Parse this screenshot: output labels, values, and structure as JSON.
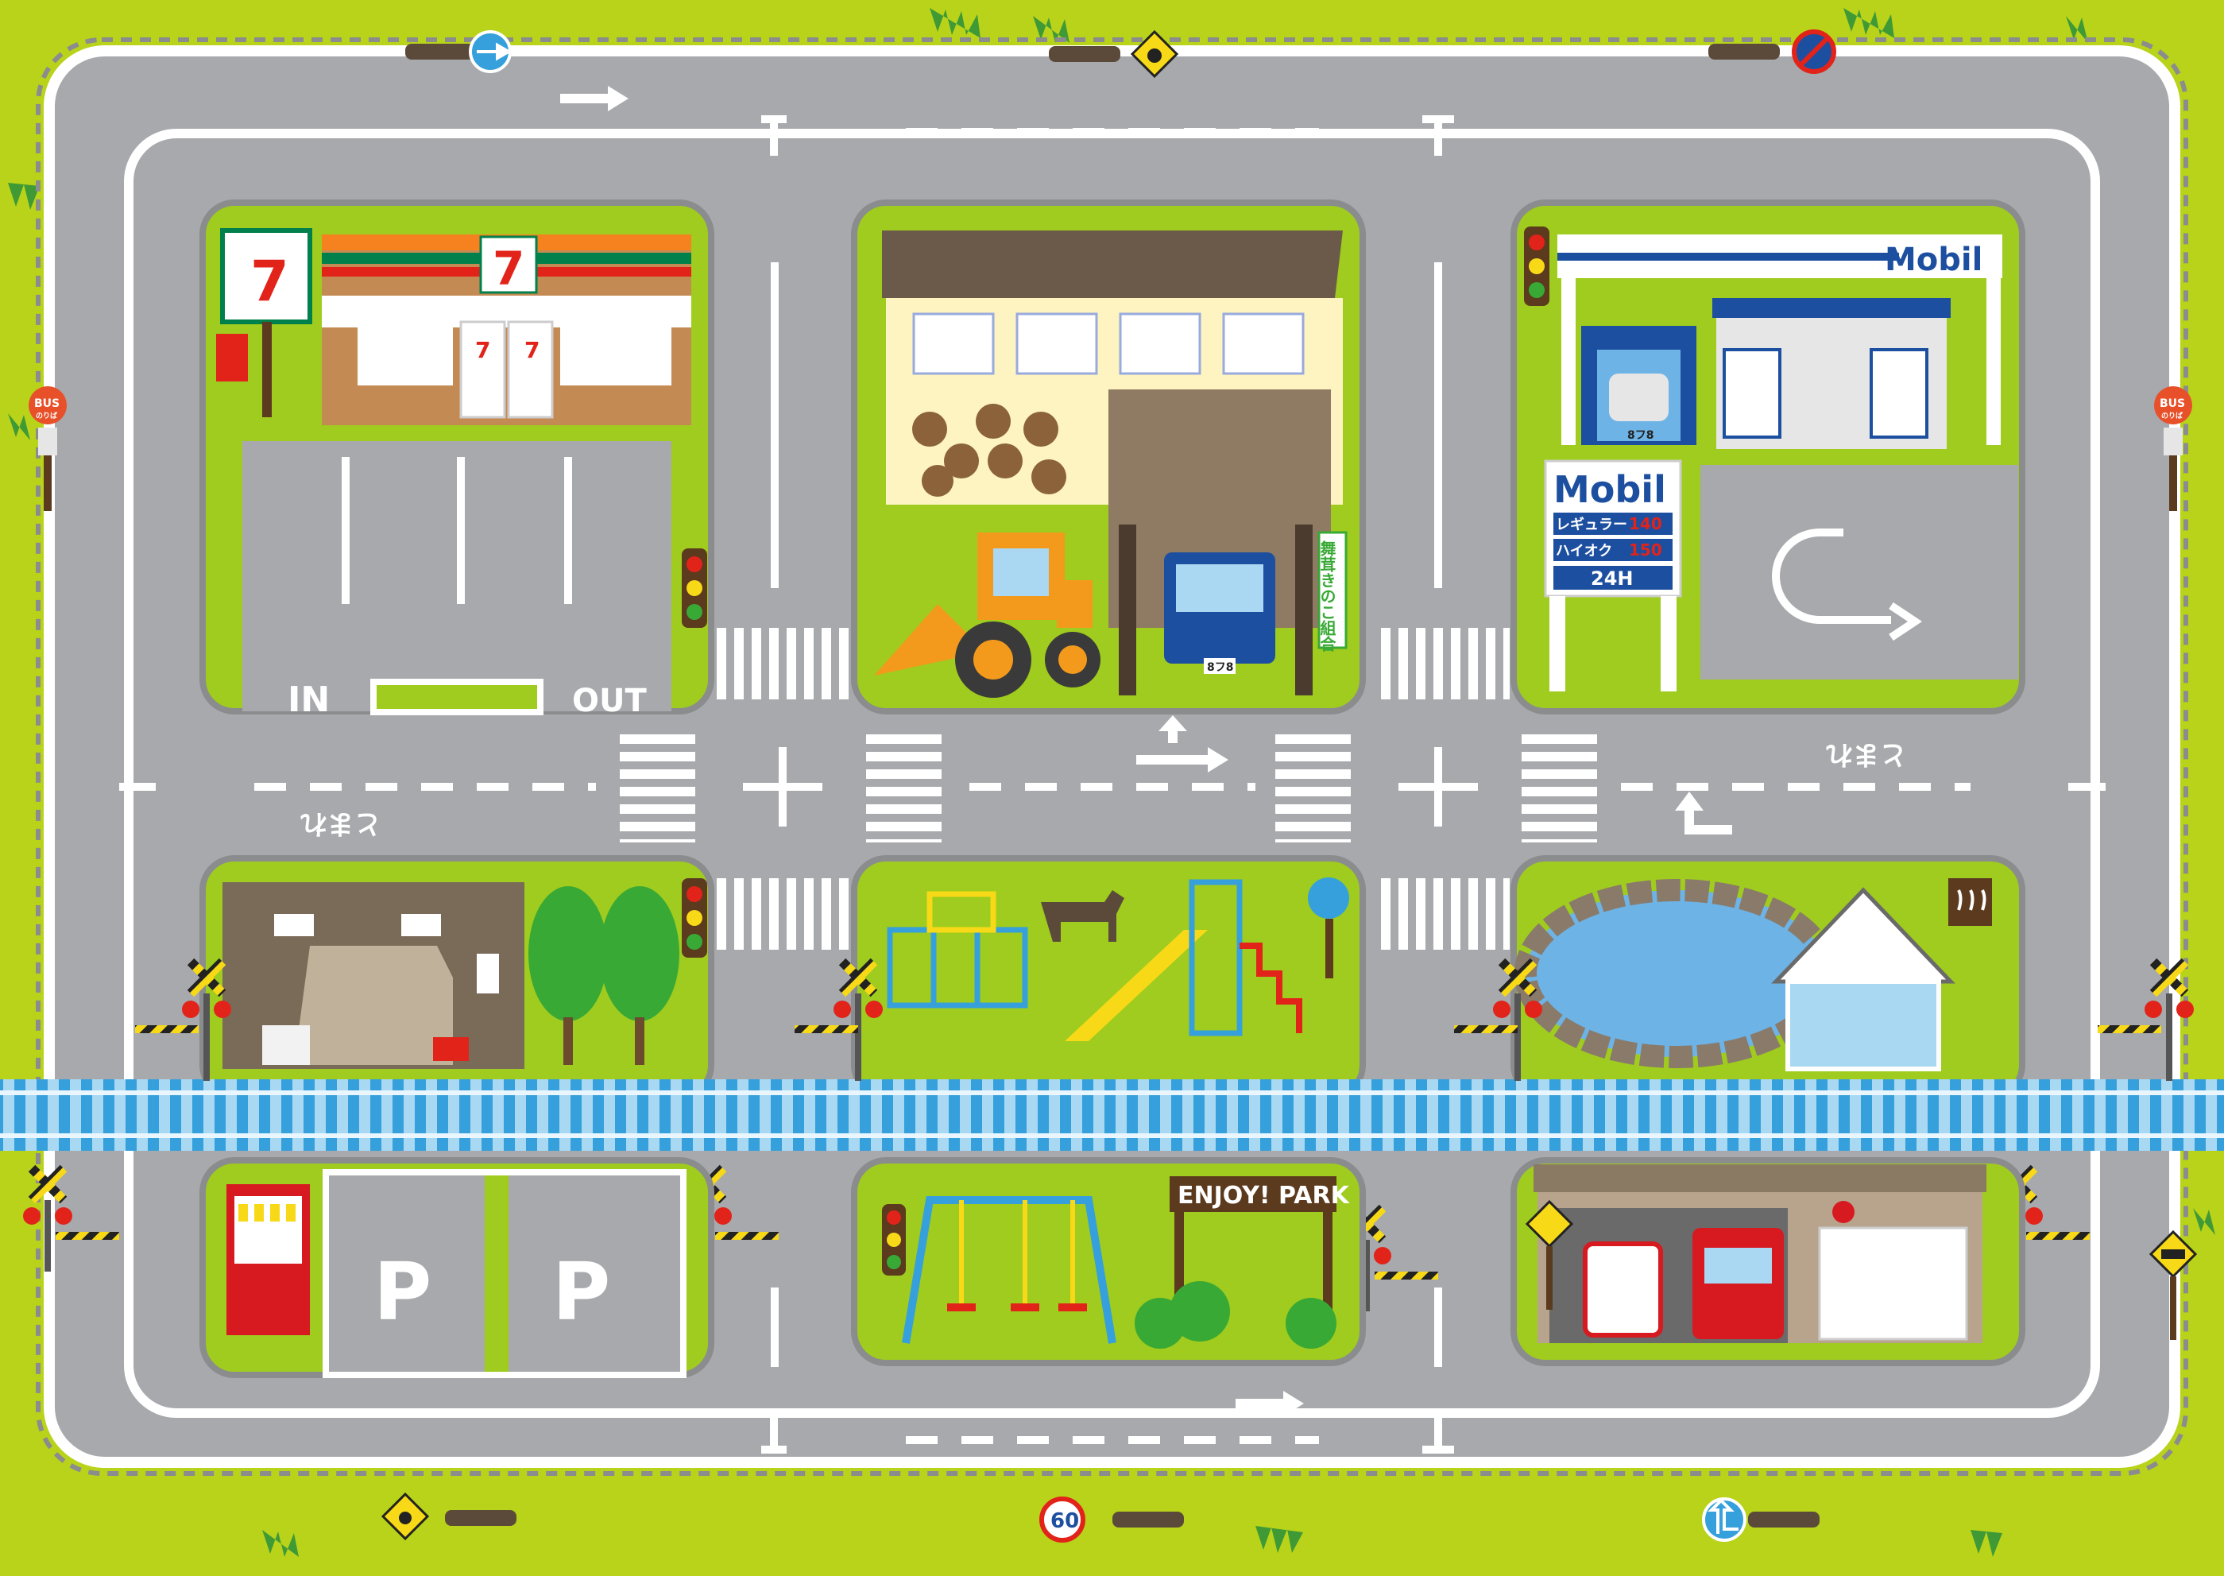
{
  "colors": {
    "grass": "#b9d31a",
    "block_grass": "#9fcc1e",
    "road": "#a7a9ac",
    "road_edge": "#ffffff",
    "curb": "#8a8c8e",
    "rail_blue": "#36a0dc",
    "mobil_blue": "#1d4fa0",
    "mobil_red": "#e2231a",
    "seven_green": "#00804a",
    "seven_orange": "#f5821f",
    "seven_red": "#e2231a",
    "fire_red": "#d71920",
    "bus_stop_red": "#e8502a"
  },
  "store": {
    "left_logo": "7",
    "sign_logo": "7",
    "window_logo_a": "7",
    "window_logo_b": "7",
    "parking_in": "IN",
    "parking_out": "OUT"
  },
  "gas_station": {
    "canopy_brand": "Mobil",
    "pole_brand": "Mobil",
    "price_label_regular": "レギュラー",
    "price_regular": "140",
    "price_label_premium": "ハイオク",
    "price_premium": "150",
    "hours": "24H",
    "car_plate": "8フ8"
  },
  "farm": {
    "vertical_sign": "舞茸きのこ組合",
    "truck_plate": "8フ8"
  },
  "park": {
    "sign": "ENJOY! PARK"
  },
  "road_text": {
    "tomare_left": "とまれ",
    "tomare_right": "とまれ"
  },
  "parking_lot": {
    "p1": "P",
    "p2": "P"
  },
  "signs": {
    "bus_left": "BUS",
    "bus_left_sub": "のりば",
    "bus_right": "BUS",
    "bus_right_sub": "のりば",
    "speed_limit": "60"
  },
  "icons": {
    "one_way": "one-way-arrow-icon",
    "no_parking": "no-parking-icon",
    "animal_warning": "animal-crossing-icon",
    "pedestrian": "pedestrian-icon",
    "onsen": "hot-spring-icon",
    "school_zone": "school-zone-icon",
    "railroad": "railroad-crossing-icon",
    "uturn_arrow": "u-turn-arrow-icon"
  }
}
